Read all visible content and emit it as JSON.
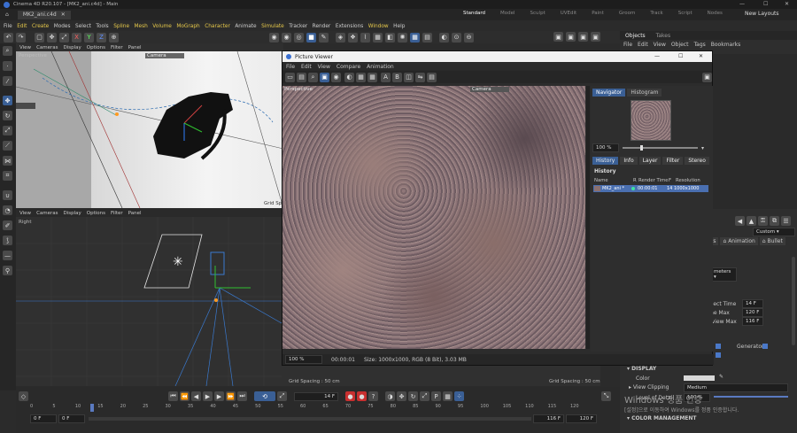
{
  "titlebar": {
    "title": "Cinema 4D R20.107 - [MK2_ani.c4d] - Main"
  },
  "doc_tab": {
    "label": "MK2_ani.c4d"
  },
  "layouts": {
    "items": [
      "Standard",
      "Model",
      "Sculpt",
      "UVEdit",
      "Paint",
      "Groom",
      "Track",
      "Script",
      "Nodes"
    ],
    "new_layouts": "New Layouts"
  },
  "main_menu": [
    "File",
    "Edit",
    "Create",
    "Modes",
    "Select",
    "Tools",
    "Spline",
    "Mesh",
    "Volume",
    "MoGraph",
    "Character",
    "Animate",
    "Simulate",
    "Tracker",
    "Render",
    "Extensions",
    "Window",
    "Help"
  ],
  "toolbar_axes": [
    "X",
    "Y",
    "Z"
  ],
  "viewport_top": {
    "menu": [
      "View",
      "Cameras",
      "Display",
      "Options",
      "Filter",
      "Panel"
    ],
    "label_perspective": "Perspective",
    "label_camera": "Camera",
    "label_grid": "Grid Sp"
  },
  "viewport_bottom": {
    "menu": [
      "View",
      "Cameras",
      "Display",
      "Options",
      "Filter",
      "Panel"
    ],
    "label": "Right",
    "grid_left": "Grid Spacing : 50 cm",
    "grid_right": "Grid Spacing : 50 cm"
  },
  "objects_panel": {
    "tabs": [
      "Objects",
      "Takes"
    ],
    "menu": [
      "File",
      "Edit",
      "View",
      "Object",
      "Tags",
      "Bookmarks"
    ]
  },
  "picture_viewer": {
    "title": "Picture Viewer",
    "menu": [
      "File",
      "Edit",
      "View",
      "Compare",
      "Animation"
    ],
    "img_label_left": "Perspective",
    "img_label_right": "Camera",
    "tabs_top": [
      "Navigator",
      "Histogram"
    ],
    "zoom": "100 %",
    "tabs_bottom": [
      "History",
      "Info",
      "Layer",
      "Filter",
      "Stereo"
    ],
    "history_title": "History",
    "history_columns": [
      "Name",
      "R",
      "Render Time",
      "F",
      "Resolution"
    ],
    "history_row": {
      "name": "MK2_ani *",
      "time": "00:00:01",
      "frame": "14",
      "res": "1000x1000"
    },
    "status_zoom": "100 %",
    "status_time": "00:00:01",
    "status_info": "Size: 1000x1000, RGB (8 Bit), 3.03 MB"
  },
  "attributes": {
    "custom": "Custom",
    "tabs": [
      "ts",
      "Animation",
      "Bullet"
    ],
    "units": "meters",
    "rows": [
      {
        "label": "oject Time",
        "value": "14 F"
      },
      {
        "label": "me Max",
        "value": "120 F"
      },
      {
        "label": "eview Max",
        "value": "116 F"
      }
    ],
    "generators": "Generators",
    "display_header": "DISPLAY",
    "color_label": "Color",
    "view_clipping_label": "View Clipping",
    "view_clipping_value": "Medium",
    "lod_label": "Level of Detail",
    "lod_value": "100 %",
    "color_mgmt": "COLOR MANAGEMENT"
  },
  "timeline": {
    "ticks": [
      "0",
      "5",
      "10",
      "15",
      "20",
      "25",
      "30",
      "35",
      "40",
      "45",
      "50",
      "55",
      "60",
      "65",
      "70",
      "75",
      "80",
      "85",
      "90",
      "95",
      "100",
      "105",
      "110",
      "115",
      "120"
    ],
    "current_frame": "14 F",
    "start": "0 F",
    "start2": "0 F",
    "end": "116 F",
    "end2": "120 F"
  },
  "watermark": {
    "line1": "Windows 정품 인증",
    "line2": "[설정]으로 이동하여 Windows를 정품 인증합니다."
  },
  "colors": {
    "accent": "#3a5f95",
    "orange": "#e0a000",
    "selected": "#4a6fb0"
  }
}
